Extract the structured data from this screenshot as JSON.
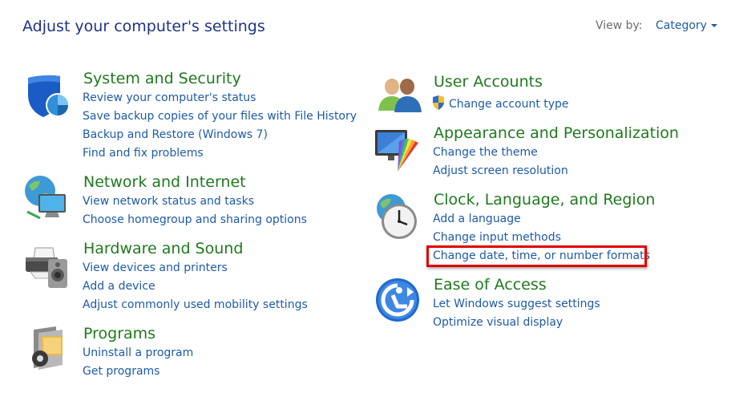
{
  "header": {
    "title": "Adjust your computer's settings",
    "view_by_label": "View by:",
    "view_by_value": "Category"
  },
  "categories": [
    {
      "title": "System and Security",
      "icon": "shield-icon",
      "links": [
        "Review your computer's status",
        "Save backup copies of your files with File History",
        "Backup and Restore (Windows 7)",
        "Find and fix problems"
      ]
    },
    {
      "title": "Network and Internet",
      "icon": "network-globe-icon",
      "links": [
        "View network status and tasks",
        "Choose homegroup and sharing options"
      ]
    },
    {
      "title": "Hardware and Sound",
      "icon": "printer-speaker-icon",
      "links": [
        "View devices and printers",
        "Add a device",
        "Adjust commonly used mobility settings"
      ]
    },
    {
      "title": "Programs",
      "icon": "programs-box-icon",
      "links": [
        "Uninstall a program",
        "Get programs"
      ]
    },
    {
      "title": "User Accounts",
      "icon": "users-icon",
      "links": [
        "Change account type"
      ]
    },
    {
      "title": "Appearance and Personalization",
      "icon": "monitor-color-icon",
      "links": [
        "Change the theme",
        "Adjust screen resolution"
      ]
    },
    {
      "title": "Clock, Language, and Region",
      "icon": "clock-globe-icon",
      "links": [
        "Add a language",
        "Change input methods",
        "Change date, time, or number formats"
      ]
    },
    {
      "title": "Ease of Access",
      "icon": "ease-of-access-icon",
      "links": [
        "Let Windows suggest settings",
        "Optimize visual display"
      ]
    }
  ],
  "highlight_color": "#e00000"
}
